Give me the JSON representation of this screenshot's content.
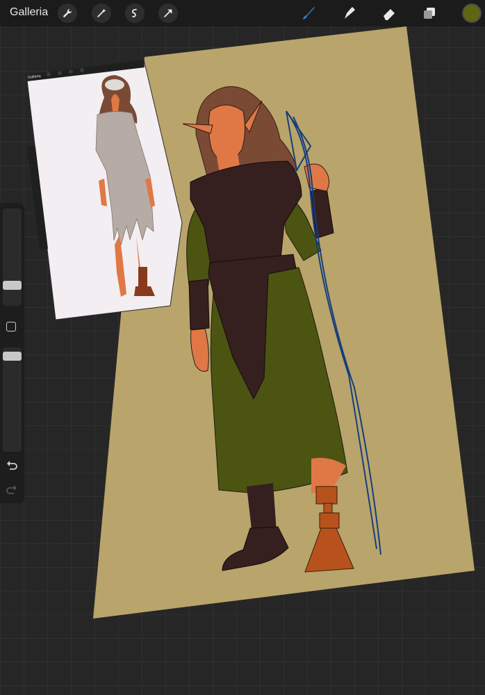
{
  "app": {
    "gallery_label": "Galleria"
  },
  "toolbar": {
    "left_tools": [
      "wrench-icon",
      "magic-wand-icon",
      "selection-icon",
      "transform-arrow-icon"
    ],
    "right_tools": [
      "brush-icon",
      "smudge-icon",
      "eraser-icon",
      "layers-icon"
    ],
    "active_tool": "brush-icon",
    "active_tool_color": "#2f7bd6",
    "current_color": "#5e6614"
  },
  "reference": {
    "gallery_label": "Galleria"
  },
  "canvas": {
    "paper_color": "#b9a46b",
    "reference_bg": "#f3eef1"
  },
  "sidebar": {
    "brush_size_level": 0.3,
    "opacity_level": 0.5,
    "undo_icon": "undo-icon",
    "redo_icon": "redo-icon",
    "modify_icon": "square-modify-icon"
  }
}
